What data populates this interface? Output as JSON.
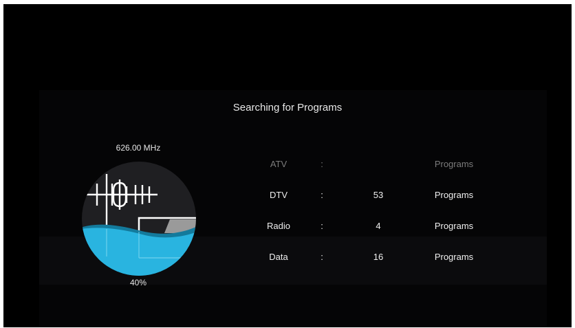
{
  "dialog": {
    "title": "Searching for Programs",
    "frequency": "626.00 MHz",
    "progress_label": "40%",
    "progress_fraction": 0.4
  },
  "results": [
    {
      "name": "ATV",
      "colon": ":",
      "count": "",
      "unit": "Programs",
      "dimmed": true
    },
    {
      "name": "DTV",
      "colon": ":",
      "count": "53",
      "unit": "Programs",
      "dimmed": false
    },
    {
      "name": "Radio",
      "colon": ":",
      "count": "4",
      "unit": "Programs",
      "dimmed": false
    },
    {
      "name": "Data",
      "colon": ":",
      "count": "16",
      "unit": "Programs",
      "dimmed": false
    }
  ],
  "colors": {
    "background": "#000000",
    "gauge_disc": "#1f1f22",
    "water": "#29b4e0",
    "water_back": "#137a9c",
    "text": "#f0f0f0",
    "dim_text": "#7c7c7c"
  },
  "icons": {
    "gauge": "antenna-tv-icon"
  }
}
